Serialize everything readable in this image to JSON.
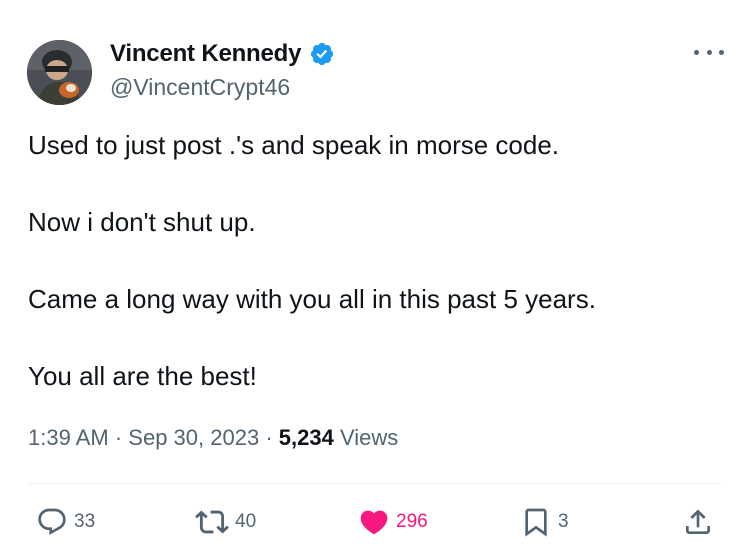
{
  "author": {
    "display_name": "Vincent Kennedy",
    "handle": "@VincentCrypt46",
    "verified": true,
    "verified_color": "#1d9bf0"
  },
  "tweet": {
    "paragraphs": [
      "Used to just post .'s and speak in morse code.",
      "Now i don't shut up.",
      "Came a long way with you all in this past 5 years.",
      "You all are the best!"
    ],
    "time": "1:39 AM",
    "separator": "·",
    "date": "Sep 30, 2023",
    "views_count": "5,234",
    "views_label": "Views"
  },
  "actions": {
    "reply": {
      "icon": "reply-icon",
      "count": "33"
    },
    "retweet": {
      "icon": "retweet-icon",
      "count": "40"
    },
    "like": {
      "icon": "heart-icon",
      "count": "296",
      "liked": true,
      "color": "#f91880"
    },
    "bookmark": {
      "icon": "bookmark-icon",
      "count": "3"
    },
    "share": {
      "icon": "share-icon"
    }
  },
  "colors": {
    "text_primary": "#0f1419",
    "text_secondary": "#536471",
    "like_active": "#f91880",
    "verified": "#1d9bf0"
  }
}
